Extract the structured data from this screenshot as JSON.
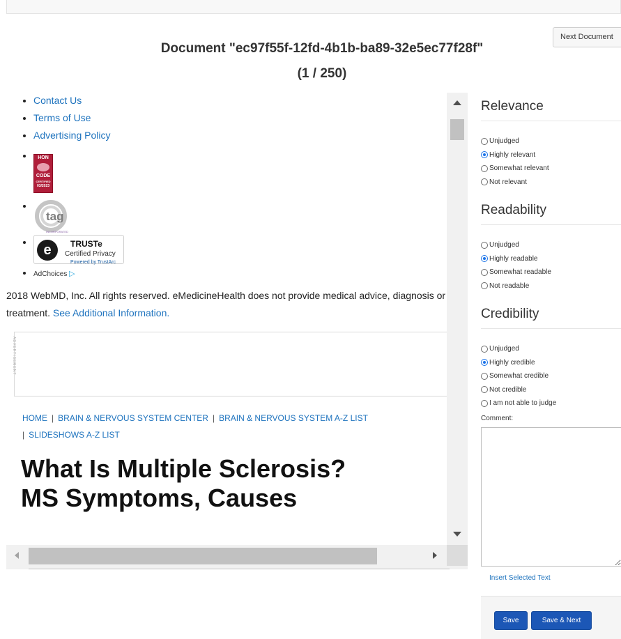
{
  "header": {
    "next_document_label": "Next Document",
    "document_title": "Document \"ec97f55f-12fd-4b1b-ba89-32e5ec77f28f\" (1 / 250)"
  },
  "viewer": {
    "links": [
      "Contact Us",
      "Terms of Use",
      "Advertising Policy"
    ],
    "badges": {
      "hon": [
        "HON",
        "CODE",
        "CERTIFIED",
        "03/2023"
      ],
      "tag": "tag",
      "tag_sub": "INCORPORATED",
      "truste_title": "TRUSTe",
      "truste_sub": "Certified Privacy",
      "truste_powered": "Powered by TrustArc",
      "adchoices": "AdChoices"
    },
    "copyright_text": "2018 WebMD, Inc. All rights reserved. eMedicineHealth does not provide medical advice, diagnosis or treatment.",
    "copyright_link": "See Additional Information.",
    "ad_label": "ADVERTISEMENT",
    "breadcrumbs": {
      "home": "HOME",
      "center": "BRAIN & NERVOUS SYSTEM CENTER",
      "az": "BRAIN & NERVOUS SYSTEM A-Z LIST",
      "slideshows": "SLIDESHOWS A-Z LIST"
    },
    "article_title": "What Is Multiple Sclerosis? MS Symptoms, Causes"
  },
  "panel": {
    "relevance": {
      "title": "Relevance",
      "options": [
        "Unjudged",
        "Highly relevant",
        "Somewhat relevant",
        "Not relevant"
      ],
      "selected": "Highly relevant"
    },
    "readability": {
      "title": "Readability",
      "options": [
        "Unjudged",
        "Highly readable",
        "Somewhat readable",
        "Not readable"
      ],
      "selected": "Highly readable"
    },
    "credibility": {
      "title": "Credibility",
      "options": [
        "Unjudged",
        "Highly credible",
        "Somewhat credible",
        "Not credible",
        "I am not able to judge"
      ],
      "selected": "Highly credible"
    },
    "comment_label": "Comment:",
    "comment_value": "",
    "insert_selected_text": "Insert Selected Text",
    "save_label": "Save",
    "save_next_label": "Save & Next"
  },
  "colors": {
    "link": "#1e73be",
    "primary_button": "#1c57b6",
    "radio_checked": "#1a73e8"
  }
}
